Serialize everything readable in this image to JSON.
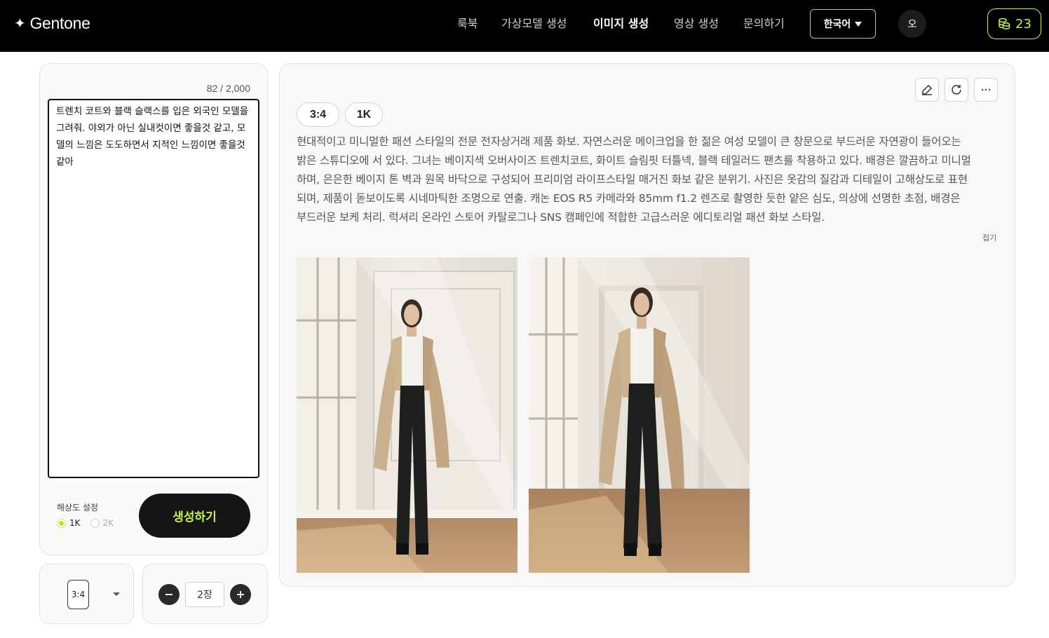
{
  "header": {
    "logo": "Gentone",
    "nav": [
      "룩북",
      "가상모델 생성",
      "이미지 생성",
      "영상 생성",
      "문의하기"
    ],
    "active_nav": "이미지 생성",
    "language": "한국어",
    "avatar_initial": "오",
    "credits": "23",
    "accent_color": "#c6f24a"
  },
  "prompt_panel": {
    "char_count": "82 / 2,000",
    "prompt_text": "트렌치 코트와 블랙 슬랙스를 입은 외국인 모델을 그려줘. 야외가 아닌 실내컷이면 좋을것 같고, 모델의 느낌은 도도하면서 지적인 느낌이면 좋을것 같아",
    "resolution_label": "해상도 설정",
    "resolution_options": [
      "1K",
      "2K"
    ],
    "selected_resolution": "1K",
    "generate_label": "생성하기"
  },
  "ratio_control": {
    "value": "3:4"
  },
  "count_control": {
    "value": "2장",
    "minus": "−",
    "plus": "+"
  },
  "result": {
    "tags": [
      "3:4",
      "1K"
    ],
    "description": "현대적이고 미니멀한 패션 스타일의 전문 전자상거래 제품 화보. 자연스러운 메이크업을 한 젊은 여성 모델이 큰 창문으로 부드러운 자연광이 들어오는 밝은 스튜디오에 서 있다. 그녀는 베이지색 오버사이즈 트렌치코트, 화이트 슬림핏 터틀넥, 블랙 테일러드 팬츠를 착용하고 있다. 배경은 깔끔하고 미니멀하며, 은은한 베이지 톤 벽과 원목 바닥으로 구성되어 프리미엄 라이프스타일 매거진 화보 같은 분위기. 사진은 옷감의 질감과 디테일이 고해상도로 표현되며, 제품이 돋보이도록 시네마틱한 조명으로 연출. 캐논 EOS R5 카메라와 85mm f1.2 렌즈로 촬영한 듯한 얕은 심도, 의상에 선명한 초점, 배경은 부드러운 보케 처리. 럭셔리 온라인 스토어 카탈로그나 SNS 캠페인에 적합한 고급스러운 에디토리얼 패션 화보 스타일.",
    "fold_label": "접기",
    "tools": [
      "edit-icon",
      "refresh-icon",
      "more-icon"
    ],
    "images": [
      "generated-image-1",
      "generated-image-2"
    ]
  }
}
